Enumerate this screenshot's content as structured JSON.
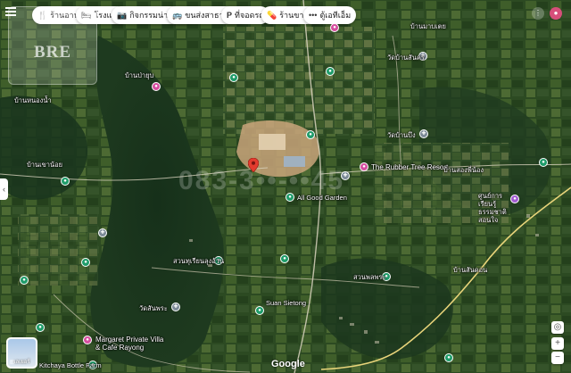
{
  "categories": [
    {
      "label": "ร้านอาหาร",
      "icon": "restaurant-icon"
    },
    {
      "label": "โรงแรม",
      "icon": "hotel-icon"
    },
    {
      "label": "กิจกรรมน่าสนใจ",
      "icon": "camera-icon"
    },
    {
      "label": "ขนส่งสาธารณะ",
      "icon": "transit-icon"
    },
    {
      "label": "ที่จอดรถ",
      "icon": "parking-icon"
    },
    {
      "label": "ร้านขายยา",
      "icon": "pharmacy-icon"
    },
    {
      "label": "ตู้เอทีเอ็ม",
      "icon": "more-icon"
    }
  ],
  "logo_text": "BRE",
  "watermark": "083-3••-••45",
  "places": [
    {
      "name": "The Rubber Tree Resort",
      "type": "pink"
    },
    {
      "name": "Margaret Private Villa & Cafe Rayong",
      "type": "pink"
    },
    {
      "name": "วัดบ้านบึง",
      "type": "gray"
    },
    {
      "name": "วัดสันพระ",
      "type": "gray"
    },
    {
      "name": "วัดบ้านสันคร",
      "type": "gray"
    },
    {
      "name": "ศูนย์การเรียนรู้ ธรรมชาติสอนใจ",
      "type": "purple"
    },
    {
      "name": "Kitchaya Bottle Farm",
      "type": "green"
    },
    {
      "name": "Suan Sietong",
      "type": "green"
    },
    {
      "name": "All Good Garden",
      "type": "green"
    },
    {
      "name": "สวนทุเรียนลุงอ้วน",
      "type": "green"
    },
    {
      "name": "สวนพลพระ",
      "type": "green"
    }
  ],
  "map_labels": [
    "บ้านสองพี่น้อง",
    "บ้านหนองน้ำ",
    "บ้านสันดอน",
    "บ้านเขาน้อย",
    "บ้านป่ายุบ",
    "บ้านมาบเตย"
  ],
  "layers_label": "เลเยอร์",
  "google_label": "Google",
  "controls": {
    "zoom_in": "+",
    "zoom_out": "−",
    "locate": "◎"
  }
}
